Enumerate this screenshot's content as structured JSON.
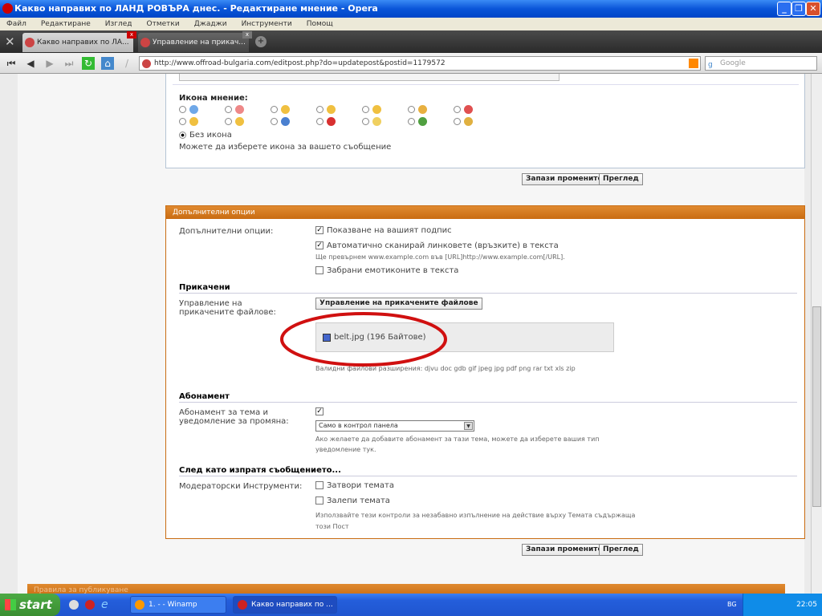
{
  "window": {
    "title": "Какво направих по ЛАНД РОВЪРА днес. - Редактиране мнение - Opera"
  },
  "menu": [
    "Файл",
    "Редактиране",
    "Изглед",
    "Отметки",
    "Джаджи",
    "Инструменти",
    "Помощ"
  ],
  "tabs": [
    {
      "label": "Какво направих по ЛА..."
    },
    {
      "label": "Управление на прикач..."
    }
  ],
  "address": {
    "url": "http://www.offroad-bulgaria.com/editpost.php?do=updatepost&postid=1179572",
    "search_placeholder": "Google"
  },
  "post_icon": {
    "label": "Икона мнение:",
    "no_icon": "Без икона",
    "hint": "Можете да изберете икона за вашето съобщение",
    "icons": [
      [
        "document",
        "#6fa8e8"
      ],
      [
        "thumbs-down",
        "#e88"
      ],
      [
        "smile",
        "#f0c040"
      ],
      [
        "wink",
        "#f0c040"
      ],
      [
        "grin",
        "#f0c040"
      ],
      [
        "sad",
        "#e8b040"
      ],
      [
        "angry",
        "#e05050"
      ],
      [
        "happy",
        "#f0c040"
      ],
      [
        "cool",
        "#f0c040"
      ],
      [
        "question",
        "#4a80d0"
      ],
      [
        "exclamation",
        "#d83030"
      ],
      [
        "lightbulb",
        "#f0d060"
      ],
      [
        "arrow",
        "#50a040"
      ],
      [
        "thumbs-up",
        "#e0b040"
      ]
    ]
  },
  "buttons": {
    "save": "Запази промените",
    "preview": "Преглед"
  },
  "extra": {
    "header": "Допълнителни опции",
    "label": "Допълнителни опции:",
    "opt_signature": "Показване на вашият подпис",
    "opt_links": "Автоматично сканирай линковете (връзките) в текста",
    "opt_links_hint": "Ще превърнем www.example.com във [URL]http://www.example.com[/URL].",
    "opt_smilies": "Забрани емотиконите в текста"
  },
  "attach": {
    "section": "Прикачени",
    "label": "Управление на прикачените файлове:",
    "button": "Управление на прикачените файлове",
    "file": "belt.jpg (196 Байтове)",
    "extensions": "Валидни файлови разширения: djvu doc gdb gif jpeg jpg pdf png rar txt xls zip"
  },
  "subscribe": {
    "section": "Абонамент",
    "label": "Абонамент за тема и уведомление за промяна:",
    "select": "Само в контрол панела",
    "hint": "Ако желаете да добавите абонамент за тази тема, можете да изберете вашия тип уведомление тук."
  },
  "after": {
    "section": "След като изпратя съобщението...",
    "label": "Модераторски Инструменти:",
    "close": "Затвори темата",
    "stick": "Залепи темата",
    "hint": "Използвайте тези контроли за незабавно изпълнение на действие върху Темата съдържаща този Пост"
  },
  "bottom_header": "Правила за публикуване",
  "taskbar": {
    "start": "start",
    "items": [
      "1. - - Winamp",
      "Какво направих по ..."
    ],
    "lang": "BG",
    "time": "22:05"
  },
  "colors": {
    "accent": "#d0781e",
    "annotation": "#d01010"
  }
}
